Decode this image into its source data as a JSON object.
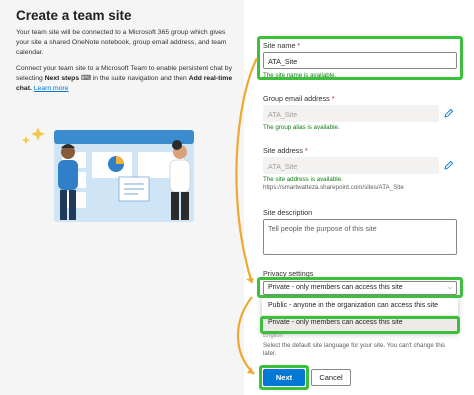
{
  "dialog": {
    "title": "Create a team site",
    "intro": "Your team site will be connected to a Microsoft 365 group which gives your site a shared OneNote notebook, group email address, and team calendar.",
    "connect_pre": "Connect your team site to a Microsoft Team to enable persistent chat by selecting ",
    "connect_next": "Next steps",
    "connect_mid": " in the suite navigation and then ",
    "connect_add": "Add real-time chat.",
    "learn_more": "Learn more"
  },
  "form": {
    "site_name": {
      "label": "Site name",
      "required": "*",
      "value": "ATA_Site",
      "message": "The site name is available."
    },
    "group_email": {
      "label": "Group email address",
      "required": "*",
      "value": "ATA_Site",
      "message": "The group alias is available."
    },
    "site_address": {
      "label": "Site address",
      "required": "*",
      "value": "ATA_Site",
      "message": "The site address is available.",
      "url": "https://smartwatteza.sharepoint.com/sites/ATA_Site"
    },
    "site_description": {
      "label": "Site description",
      "placeholder": "Tell people the purpose of this site"
    },
    "privacy": {
      "label": "Privacy settings",
      "selected": "Private - only members can access this site",
      "options": [
        "Public - anyone in the organization can access this site",
        "Private - only members can access this site"
      ]
    },
    "language": {
      "value_partial": "English",
      "help": "Select the default site language for your site. You can't change this later."
    }
  },
  "buttons": {
    "next": "Next",
    "cancel": "Cancel"
  },
  "colors": {
    "accent": "#0078d4",
    "success": "#107c10",
    "highlight": "#3cc03c",
    "arrow": "#f0a830"
  },
  "icons": {
    "edit": "pencil-icon",
    "chevron": "chevron-down-icon",
    "chat": "chat-icon"
  }
}
